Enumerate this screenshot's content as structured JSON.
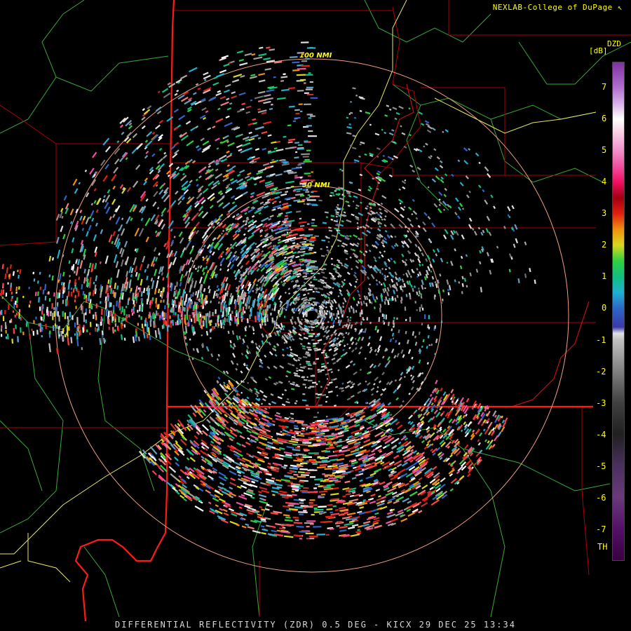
{
  "credit": "NEXLAB-College of DuPage",
  "credit_icon": "cursor-icon",
  "product": {
    "name": "DZD",
    "unit": "[dB]",
    "title": "DIFFERENTIAL REFLECTIVITY (ZDR) 0.5 DEG - KICX 29 DEC 25 13:34"
  },
  "range_rings": [
    "50 NMI",
    "100 NMI"
  ],
  "colorbar": {
    "ticks": [
      "7",
      "6",
      "5",
      "4",
      "3",
      "2",
      "1",
      "0",
      "-1",
      "-2",
      "-3",
      "-4",
      "-5",
      "-6",
      "-7"
    ],
    "th_label": "TH",
    "stops": [
      {
        "v": -8,
        "c": "#3a0040"
      },
      {
        "v": -7,
        "c": "#54106a"
      },
      {
        "v": -6,
        "c": "#6a3a7a"
      },
      {
        "v": -5,
        "c": "#4a3060"
      },
      {
        "v": -4,
        "c": "#202020"
      },
      {
        "v": -3,
        "c": "#404040"
      },
      {
        "v": -2,
        "c": "#808080"
      },
      {
        "v": -1,
        "c": "#c0c0c0"
      },
      {
        "v": -0.8,
        "c": "#e0e0e0"
      },
      {
        "v": -0.6,
        "c": "#3a3aa8"
      },
      {
        "v": 0,
        "c": "#2e66c8"
      },
      {
        "v": 0.5,
        "c": "#20b0d0"
      },
      {
        "v": 1,
        "c": "#10c080"
      },
      {
        "v": 1.5,
        "c": "#30d040"
      },
      {
        "v": 2,
        "c": "#d8d820"
      },
      {
        "v": 2.5,
        "c": "#f09010"
      },
      {
        "v": 3,
        "c": "#e02010"
      },
      {
        "v": 3.5,
        "c": "#a00010"
      },
      {
        "v": 4,
        "c": "#f01060"
      },
      {
        "v": 4.5,
        "c": "#f050a0"
      },
      {
        "v": 5,
        "c": "#f090c8"
      },
      {
        "v": 5.5,
        "c": "#f8c8e0"
      },
      {
        "v": 6,
        "c": "#ffffff"
      },
      {
        "v": 6.5,
        "c": "#d8b0e8"
      },
      {
        "v": 7,
        "c": "#b070d0"
      },
      {
        "v": 7.8,
        "c": "#8030a0"
      }
    ]
  },
  "colors": {
    "state_border": "#ff2020",
    "county_border": "#b00000",
    "highway": "#e8e860",
    "river": "#40c840",
    "range_ring": "#f0a080"
  }
}
